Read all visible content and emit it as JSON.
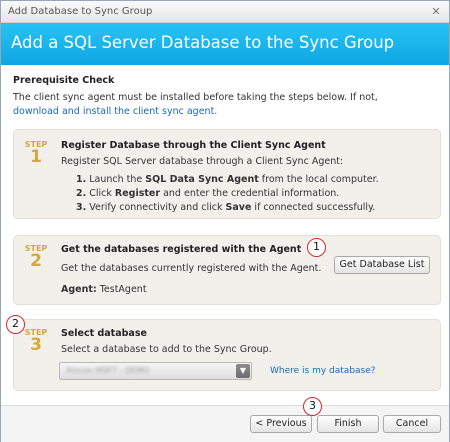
{
  "window": {
    "title": "Add Database to Sync Group",
    "close_glyph": "✕"
  },
  "banner": {
    "heading": "Add a SQL Server Database to the Sync Group"
  },
  "prerequisite": {
    "title": "Prerequisite Check",
    "text": "The client sync agent must be installed before taking the steps below. If not,",
    "link": "download and install the client sync agent."
  },
  "step_word": "STEP",
  "steps": [
    {
      "number": "1",
      "title": "Register Database through the Client Sync Agent",
      "description": "Register SQL Server database through a Client Sync Agent:",
      "items": [
        {
          "n": "1.",
          "pre": " Launch the ",
          "bold": "SQL Data Sync Agent",
          "post": " from the local computer."
        },
        {
          "n": "2.",
          "pre": " Click ",
          "bold": "Register",
          "post": " and enter the credential information."
        },
        {
          "n": "3.",
          "pre": " Verify connectivity and click ",
          "bold": "Save",
          "post": " if connected successfully."
        }
      ]
    },
    {
      "number": "2",
      "title": "Get the databases registered with the Agent",
      "description": "Get the databases currently registered with the Agent.",
      "button": "Get Database List",
      "agent_label": "Agent:",
      "agent_value": " TestAgent"
    },
    {
      "number": "3",
      "title": "Select database",
      "description": "Select a database to add to the Sync Group.",
      "select_value": "Xincon MSFT - DEMO",
      "link": "Where is my database?"
    }
  ],
  "footer": {
    "previous": "< Previous",
    "finish": "Finish",
    "cancel": "Cancel"
  },
  "markers": [
    "1",
    "2",
    "3"
  ],
  "colors": {
    "banner": "#0fa6e2",
    "step_badge": "#d4a93c",
    "link": "#1a69b5",
    "marker": "#d8262d"
  }
}
